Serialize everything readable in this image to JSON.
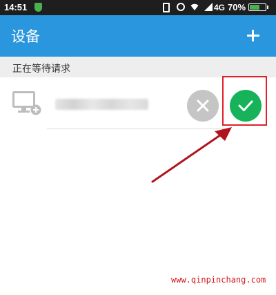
{
  "status_bar": {
    "time": "14:51",
    "network": "4G",
    "battery_percent": "70%",
    "battery_level": 0.7
  },
  "app_bar": {
    "title": "设备",
    "add_icon": "plus-icon"
  },
  "section": {
    "label": "正在等待请求"
  },
  "request": {
    "device_icon": "monitor-add-icon",
    "reject_icon": "close-icon",
    "accept_icon": "check-icon"
  },
  "annotation": {
    "highlight_color": "#e0202a",
    "arrow_color": "#b0141c"
  },
  "watermark": "www.qinpinchang.com",
  "colors": {
    "app_bar": "#2a96dd",
    "accept": "#16b35a",
    "reject": "#c5c5c5"
  }
}
